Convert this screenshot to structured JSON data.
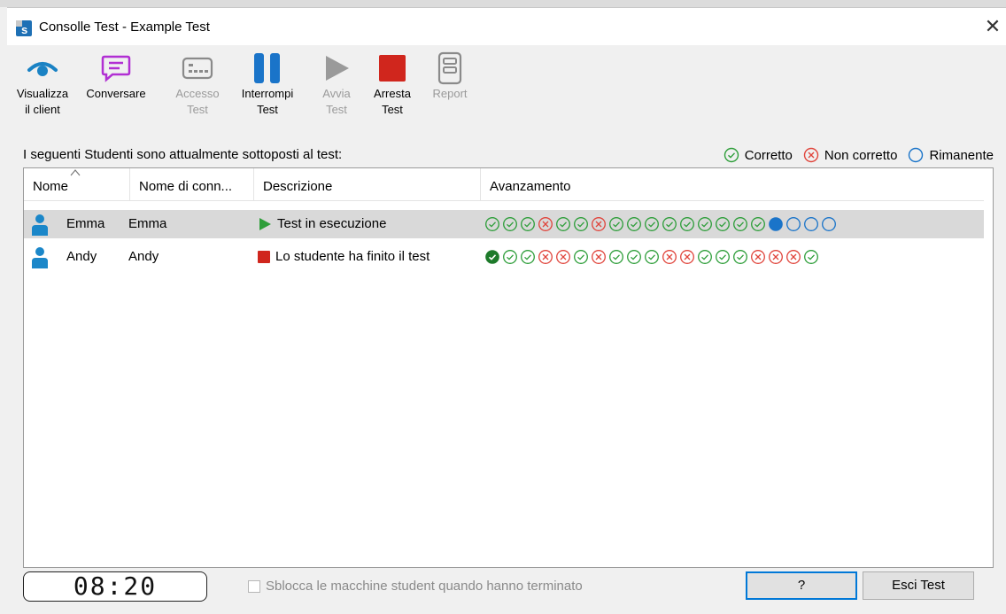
{
  "window": {
    "title": "Consolle Test - Example Test",
    "close_glyph": "✕"
  },
  "toolbar": {
    "buttons": [
      {
        "label": "Visualizza\nil client",
        "icon": "eye-icon",
        "enabled": true,
        "color": "#1a82c4"
      },
      {
        "label": "Conversare",
        "icon": "chat-icon",
        "enabled": true,
        "color": "#b12fd3"
      },
      {
        "label": "Accesso\nTest",
        "icon": "login-card-icon",
        "enabled": false
      },
      {
        "label": "Interrompi\nTest",
        "icon": "pause-icon",
        "enabled": true,
        "color": "#1a74c9"
      },
      {
        "label": "Avvia\nTest",
        "icon": "play-icon",
        "enabled": false
      },
      {
        "label": "Arresta\nTest",
        "icon": "stop-icon",
        "enabled": true,
        "color": "#d0261d"
      },
      {
        "label": "Report",
        "icon": "report-icon",
        "enabled": false
      }
    ]
  },
  "intro": "I seguenti Studenti sono attualmente sottoposti al test:",
  "legend": {
    "correct": "Corretto",
    "incorrect": "Non corretto",
    "remaining": "Rimanente"
  },
  "table": {
    "columns": [
      "Nome",
      "Nome di conn...",
      "Descrizione",
      "Avanzamento"
    ],
    "rows": [
      {
        "name": "Emma",
        "login": "Emma",
        "status": "Test in esecuzione",
        "status_icon": "play-icon",
        "progress": [
          "c",
          "c",
          "c",
          "x",
          "c",
          "c",
          "x",
          "c",
          "c",
          "c",
          "c",
          "c",
          "c",
          "c",
          "c",
          "c",
          "cur",
          "r",
          "r",
          "r"
        ]
      },
      {
        "name": "Andy",
        "login": "Andy",
        "status": "Lo studente ha finito il test",
        "status_icon": "stop-icon",
        "progress": [
          "cf",
          "c",
          "c",
          "x",
          "x",
          "c",
          "x",
          "c",
          "c",
          "c",
          "x",
          "x",
          "c",
          "c",
          "c",
          "x",
          "x",
          "x",
          "c"
        ]
      }
    ]
  },
  "footer": {
    "timer": "08:20",
    "unlock_label": "Sblocca le macchine student quando hanno terminato",
    "help_label": "?",
    "exit_label": "Esci Test"
  },
  "colors": {
    "correct": "#2e9e3a",
    "incorrect": "#e0443b",
    "remaining": "#1a74c9",
    "selected_row": "#d9d9d9"
  }
}
